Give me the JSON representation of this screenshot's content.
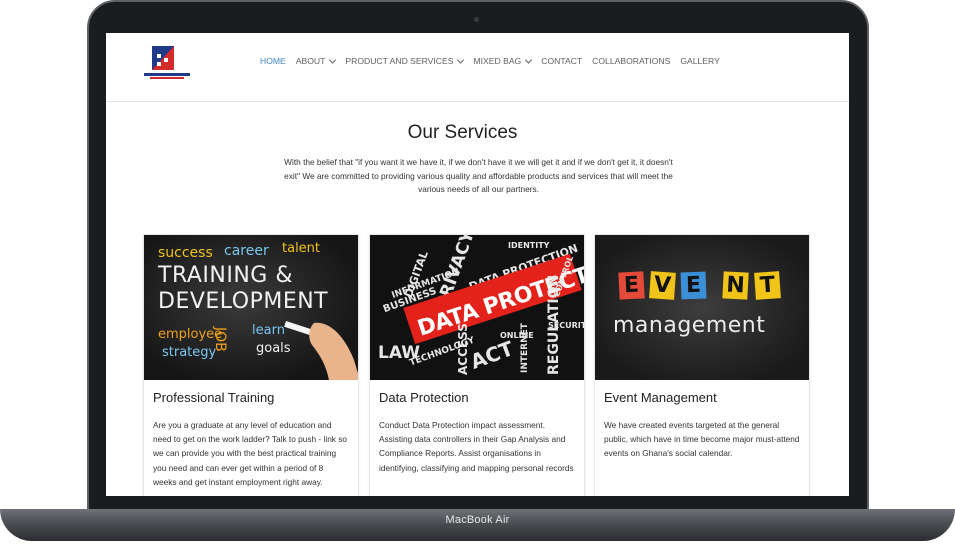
{
  "device": {
    "brand": "MacBook Air"
  },
  "header": {
    "topnote": "",
    "logo_alt": "Push Link Consult Ltd",
    "nav": [
      {
        "label": "HOME",
        "active": true,
        "dropdown": false
      },
      {
        "label": "ABOUT",
        "active": false,
        "dropdown": true
      },
      {
        "label": "PRODUCT AND SERVICES",
        "active": false,
        "dropdown": true
      },
      {
        "label": "MIXED BAG",
        "active": false,
        "dropdown": true
      },
      {
        "label": "CONTACT",
        "active": false,
        "dropdown": false
      },
      {
        "label": "COLLABORATIONS",
        "active": false,
        "dropdown": false
      },
      {
        "label": "GALLERY",
        "active": false,
        "dropdown": false
      }
    ]
  },
  "main": {
    "title": "Our Services",
    "intro": "With the belief that \"if you want it we have it, if we don't have it we will get it and if we don't get it, it doesn't exit\" We are committed to providing various quality and affordable products and services that will meet the various needs of all our partners.",
    "cards": [
      {
        "title": "Professional Training",
        "text": "Are you a graduate at any level of education and need to get on the work ladder? Talk to push - link so we can provide you with the best practical training you need and can ever get within a period of 8 weeks and get instant employment right away.",
        "image": {
          "words": [
            "success",
            "career",
            "talent",
            "TRAINING &",
            "DEVELOPMENT",
            "employee",
            "JOB",
            "learn",
            "strategy",
            "goals"
          ]
        }
      },
      {
        "title": "Data Protection",
        "text": "Conduct Data Protection impact assessment. Assisting data controllers in their Gap Analysis and Compliance Reports. Assist organisations in identifying, classifying and mapping personal records",
        "image": {
          "banner": "DATA PROTECTION",
          "words": [
            "PRIVACY",
            "DIGITAL",
            "BUSINESS",
            "INFORMATION",
            "IDENTITY",
            "DATA PROTECTION",
            "LAW",
            "TECHNOLOGY",
            "ACT",
            "ACCESS",
            "REGULATION",
            "SECURITY",
            "INTERNET",
            "CONTROL",
            "ONLINE"
          ]
        }
      },
      {
        "title": "Event Management",
        "text": "We have created events targeted at the general public, which have in time become major must-attend events on Ghana's social calendar.",
        "image": {
          "letters": [
            "E",
            "V",
            "E",
            "N",
            "T"
          ],
          "caption": "management",
          "note_colors": [
            "#e34a3a",
            "#f0c419",
            "#3a8fd6",
            "#f0c419",
            "#f0c419"
          ]
        }
      }
    ]
  }
}
